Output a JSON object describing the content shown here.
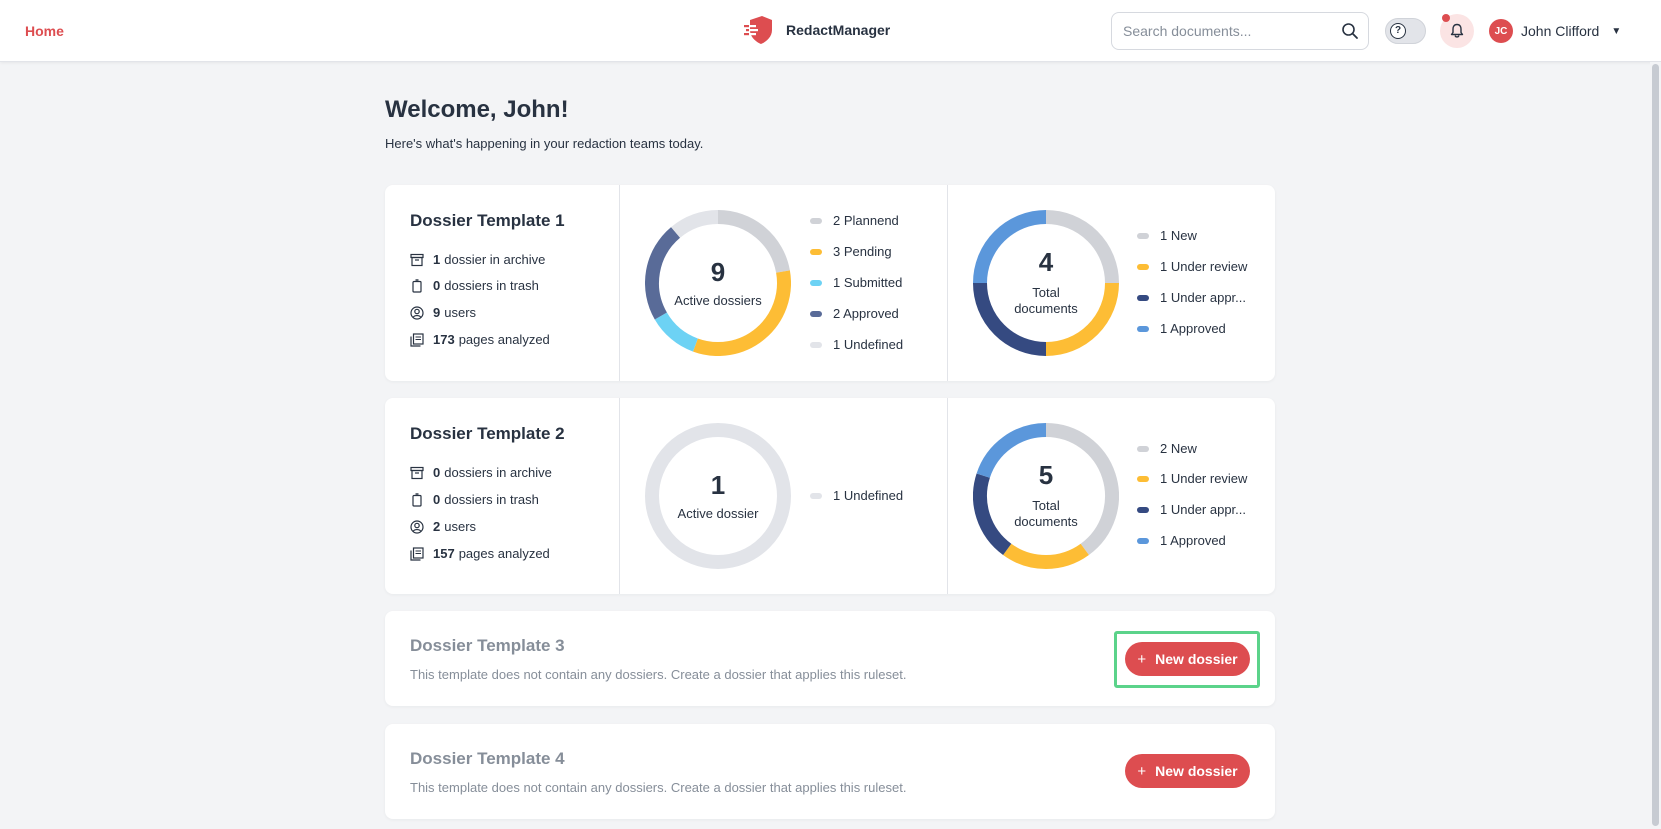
{
  "header": {
    "home_label": "Home",
    "brand_name": "RedactManager",
    "search_placeholder": "Search documents...",
    "help_symbol": "?",
    "user_initials": "JC",
    "user_name": "John Clifford",
    "user_caret": "▼"
  },
  "colors": {
    "accent": "#dd4d50",
    "new": "#d0d2d7",
    "pending": "#fdbd35",
    "submitted": "#6dd2f4",
    "approved_dossier": "#596b98",
    "undefined": "#e2e4e9",
    "under_review": "#fdbd35",
    "under_approval": "#354a81",
    "approved_doc": "#5b97db",
    "highlight": "#5bd38a"
  },
  "welcome": {
    "title": "Welcome, John!",
    "subtitle": "Here's what's happening in your redaction teams today."
  },
  "templates": [
    {
      "title": "Dossier Template 1",
      "stats": [
        {
          "icon": "archive-icon",
          "value": "1",
          "label": "dossier in archive"
        },
        {
          "icon": "trash-icon",
          "value": "0",
          "label": "dossiers in trash"
        },
        {
          "icon": "user-icon",
          "value": "9",
          "users_label": "users",
          "label": "users"
        },
        {
          "icon": "pages-icon",
          "value": "173",
          "label": "pages analyzed"
        }
      ],
      "dossiers": {
        "count": "9",
        "label": "Active dossiers",
        "legend": [
          {
            "label": "2 Plannend",
            "value": 2,
            "color": "#d0d2d7"
          },
          {
            "label": "3 Pending",
            "value": 3,
            "color": "#fdbd35"
          },
          {
            "label": "1 Submitted",
            "value": 1,
            "color": "#6dd2f4"
          },
          {
            "label": "2 Approved",
            "value": 2,
            "color": "#596b98"
          },
          {
            "label": "1 Undefined",
            "value": 1,
            "color": "#e2e4e9"
          }
        ]
      },
      "documents": {
        "count": "4",
        "label_line1": "Total",
        "label_line2": "documents",
        "legend": [
          {
            "label": "1 New",
            "value": 1,
            "color": "#d0d2d7"
          },
          {
            "label": "1 Under review",
            "value": 1,
            "color": "#fdbd35"
          },
          {
            "label": "1 Under appr...",
            "value": 1,
            "color": "#354a81"
          },
          {
            "label": "1 Approved",
            "value": 1,
            "color": "#5b97db"
          }
        ]
      }
    },
    {
      "title": "Dossier Template 2",
      "stats": [
        {
          "icon": "archive-icon",
          "value": "0",
          "label": "dossiers in archive"
        },
        {
          "icon": "trash-icon",
          "value": "0",
          "label": "dossiers in trash"
        },
        {
          "icon": "user-icon",
          "value": "2",
          "label": "users"
        },
        {
          "icon": "pages-icon",
          "value": "157",
          "label": "pages analyzed"
        }
      ],
      "dossiers": {
        "count": "1",
        "label": "Active dossier",
        "legend": [
          {
            "label": "1 Undefined",
            "value": 1,
            "color": "#e2e4e9"
          }
        ]
      },
      "documents": {
        "count": "5",
        "label_line1": "Total",
        "label_line2": "documents",
        "legend": [
          {
            "label": "2 New",
            "value": 2,
            "color": "#d0d2d7"
          },
          {
            "label": "1 Under review",
            "value": 1,
            "color": "#fdbd35"
          },
          {
            "label": "1 Under appr...",
            "value": 1,
            "color": "#354a81"
          },
          {
            "label": "1 Approved",
            "value": 1,
            "color": "#5b97db"
          }
        ]
      }
    }
  ],
  "empty_templates": [
    {
      "title": "Dossier Template 3",
      "description": "This template does not contain any dossiers. Create a dossier that applies this ruleset.",
      "button_label": "New dossier",
      "button_plus": "+"
    },
    {
      "title": "Dossier Template 4",
      "description": "This template does not contain any dossiers. Create a dossier that applies this ruleset.",
      "button_label": "New dossier",
      "button_plus": "+"
    }
  ]
}
